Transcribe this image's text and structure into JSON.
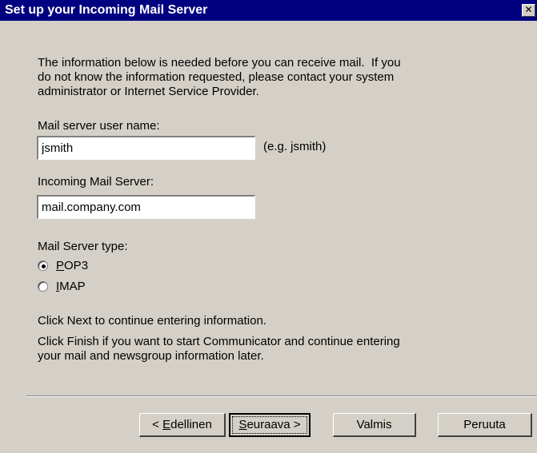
{
  "window": {
    "title": "Set up your Incoming Mail Server",
    "close_glyph": "✕"
  },
  "intro": {
    "text": "The information below is needed before you can receive mail.  If you\ndo not know the information requested, please contact your system\nadministrator or Internet Service Provider."
  },
  "user_name": {
    "label": "Mail server user name:",
    "value": "jsmith",
    "hint": "(e.g. jsmith)"
  },
  "incoming_server": {
    "label": "Incoming Mail Server:",
    "value": "mail.company.com"
  },
  "server_type": {
    "label": "Mail Server type:",
    "options": [
      {
        "mnemonic": "P",
        "rest": "OP3",
        "selected": true
      },
      {
        "mnemonic": "I",
        "rest": "MAP",
        "selected": false
      }
    ]
  },
  "instructions": {
    "next": "Click Next to continue entering information.",
    "finish": "Click Finish if you want to start Communicator and continue entering\nyour mail and newsgroup information later."
  },
  "buttons": {
    "back": {
      "prefix": "< ",
      "mnemonic": "E",
      "rest": "dellinen"
    },
    "next": {
      "mnemonic": "S",
      "rest": "euraava >"
    },
    "finish": "Valmis",
    "cancel": "Peruuta"
  }
}
